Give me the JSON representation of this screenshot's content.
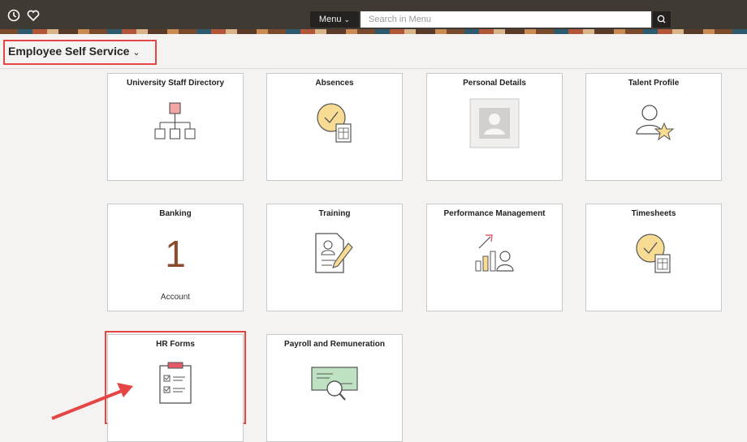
{
  "header": {
    "menu_label": "Menu",
    "search_placeholder": "Search in Menu"
  },
  "page": {
    "title": "Employee Self Service"
  },
  "tiles": [
    {
      "title": "University Staff Directory",
      "icon": "org-chart-icon"
    },
    {
      "title": "Absences",
      "icon": "clock-document-icon"
    },
    {
      "title": "Personal Details",
      "icon": "person-photo-icon"
    },
    {
      "title": "Talent Profile",
      "icon": "person-star-icon"
    },
    {
      "title": "Banking",
      "count": "1",
      "sublabel": "Account"
    },
    {
      "title": "Training",
      "icon": "form-pencil-icon"
    },
    {
      "title": "Performance Management",
      "icon": "chart-person-icon"
    },
    {
      "title": "Timesheets",
      "icon": "clock-document-icon"
    },
    {
      "title": "HR Forms",
      "icon": "clipboard-checklist-icon"
    },
    {
      "title": "Payroll and Remuneration",
      "icon": "check-magnifier-icon"
    }
  ],
  "colors": {
    "header": "#3b3632",
    "highlight": "#e64545",
    "count": "#8a4b2d"
  }
}
